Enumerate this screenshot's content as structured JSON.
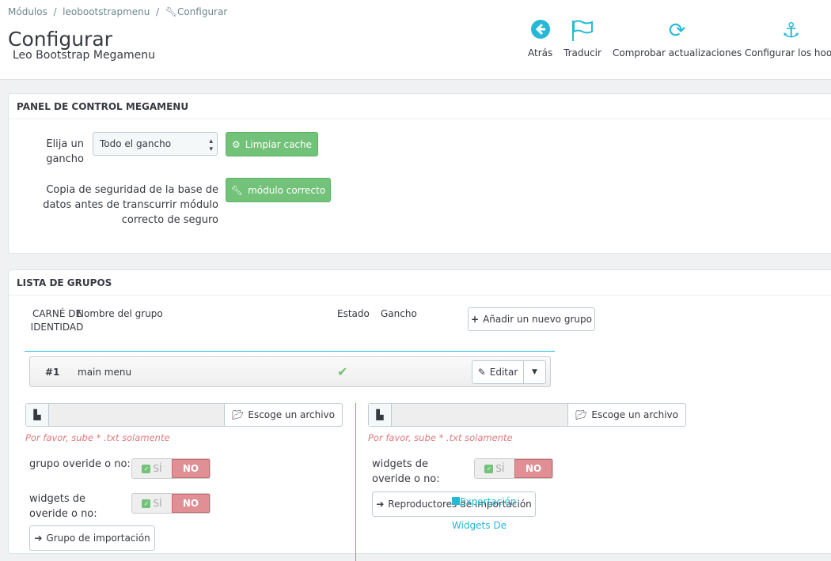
{
  "breadcrumb": [
    "Módulos",
    "leobootstrapmenu",
    "Configurar"
  ],
  "page": {
    "title": "Configurar",
    "subtitle": "Leo Bootstrap Megamenu"
  },
  "toolbar": [
    {
      "label": "Atrás",
      "icon": "arrow-circle-left-icon"
    },
    {
      "label": "Traducir",
      "icon": "flag-icon"
    },
    {
      "label": "Comprobar actualizaciones",
      "icon": "refresh-icon"
    },
    {
      "label": "Configurar los hook",
      "icon": "anchor-icon"
    }
  ],
  "control_panel": {
    "title": "PANEL DE CONTROL MEGAMENU",
    "hook_label": "Elija un gancho",
    "hook_value": "Todo el gancho",
    "clear_cache": "Limpiar cache",
    "backup_label": "Copia de seguridad de la base de datos antes de transcurrir módulo correcto de seguro",
    "fix_button": "módulo correcto"
  },
  "groups": {
    "title": "LISTA DE GRUPOS",
    "columns": [
      "CARNÉ DE IDENTIDAD",
      "Nombre del grupo",
      "Estado",
      "Gancho"
    ],
    "add_button": "Añadir un nuevo grupo",
    "rows": [
      {
        "id": "#1",
        "name": "main menu",
        "status": "enabled",
        "edit": "Editar"
      }
    ],
    "left": {
      "choose_file": "Escoge un archivo",
      "hint": "Por favor, sube * .txt solamente",
      "group_override": "grupo overide o no:",
      "widgets_override": "widgets de overide o no:",
      "yes": "SÍ",
      "no": "NO",
      "import_button": "Grupo de importación"
    },
    "right": {
      "choose_file": "Escoge un archivo",
      "hint": "Por favor, sube * .txt solamente",
      "widgets_override": "widgets de overide o no:",
      "yes": "SÍ",
      "no": "NO",
      "import_button": "Reproductores de importación",
      "export_link": "Exportación",
      "widgets_link": "Widgets De"
    }
  },
  "colors": {
    "accent": "#25b9d7",
    "success": "#72c279",
    "danger": "#e08f95"
  }
}
